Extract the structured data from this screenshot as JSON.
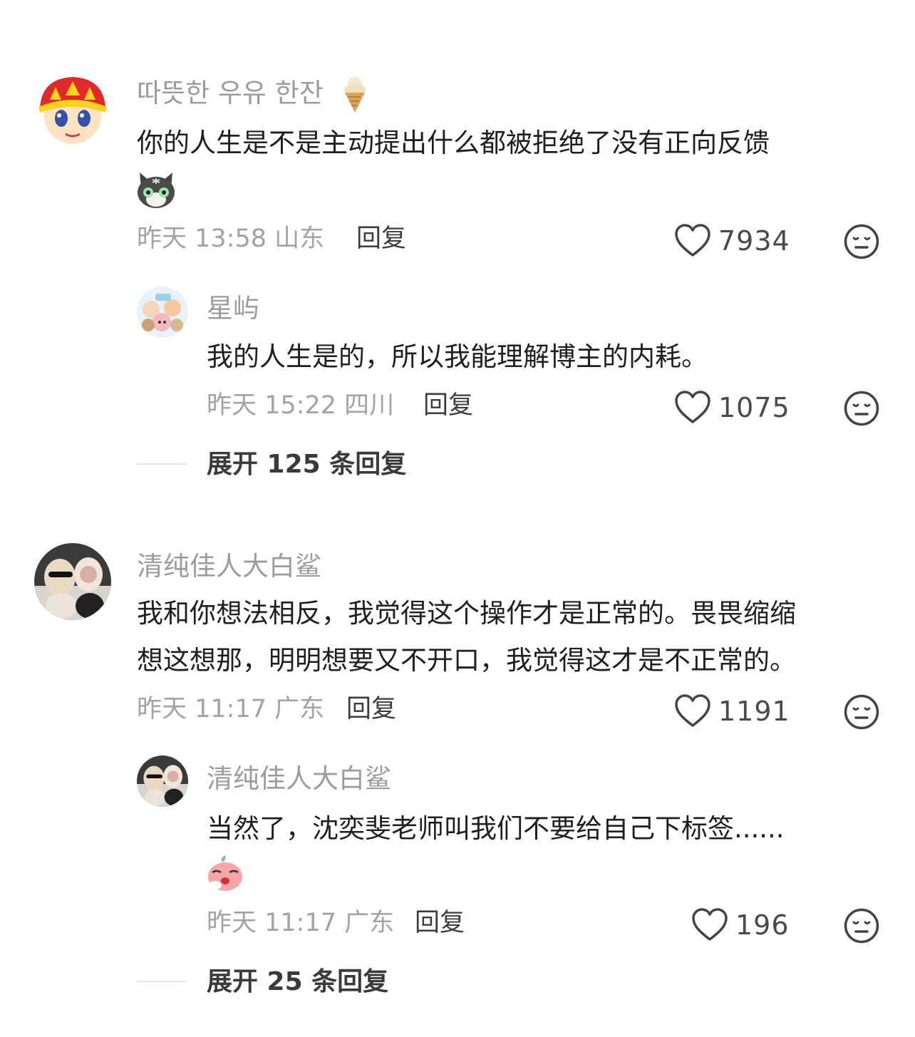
{
  "comments": [
    {
      "username": "따뜻한 우유 한잔",
      "text_line1": "你的人生是不是主动提出什么都被拒绝了没有正向反馈",
      "time": "昨天 13:58 山东",
      "reply_label": "回复",
      "likes": "7934",
      "replies": [
        {
          "username": "星屿",
          "text": "我的人生是的，所以我能理解博主的内耗。",
          "time": "昨天 15:22 四川",
          "reply_label": "回复",
          "likes": "1075"
        }
      ],
      "expand_label": "展开 125 条回复"
    },
    {
      "username": "清纯佳人大白鲨",
      "text_line1": "我和你想法相反，我觉得这个操作才是正常的。畏畏缩缩",
      "text_line2": "想这想那，明明想要又不开口，我觉得这才是不正常的。",
      "time": "昨天 11:17 广东",
      "reply_label": "回复",
      "likes": "1191",
      "replies": [
        {
          "username": "清纯佳人大白鲨",
          "text": "当然了，沈奕斐老师叫我们不要给自己下标签......",
          "time": "昨天 11:17 广东",
          "reply_label": "回复",
          "likes": "196"
        }
      ],
      "expand_label": "展开 25 条回复"
    }
  ],
  "icons": {
    "like": "heart-outline-icon",
    "dislike": "neutral-face-icon"
  },
  "colors": {
    "username": "#9c9c9c",
    "meta": "#a3a3a3",
    "text": "#1f1f1f"
  }
}
